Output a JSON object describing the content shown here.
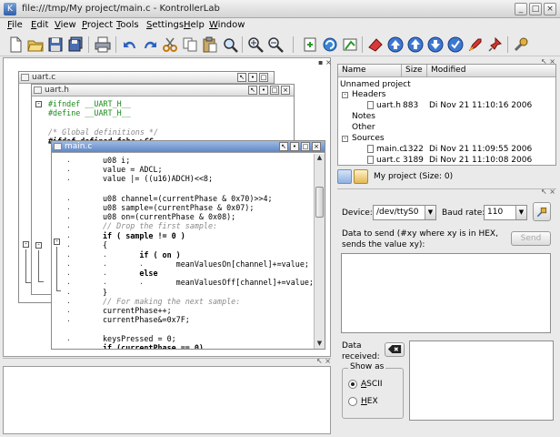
{
  "window": {
    "title": "file:///tmp/My project/main.c - KontrollerLab",
    "minimize": "_",
    "maximize": "□",
    "close": "×"
  },
  "menu": {
    "items": [
      {
        "first": "F",
        "rest": "ile"
      },
      {
        "first": "E",
        "rest": "dit"
      },
      {
        "first": "V",
        "rest": "iew"
      },
      {
        "first": "P",
        "rest": "roject"
      },
      {
        "first": "T",
        "rest": "ools"
      },
      {
        "first": "S",
        "rest": "ettings"
      },
      {
        "first": "H",
        "rest": "elp"
      },
      {
        "first": "W",
        "rest": "indow"
      }
    ]
  },
  "toolbar": {
    "icons": [
      "new-file-icon",
      "open-file-icon",
      "save-icon",
      "save-all-icon",
      "print-icon",
      "undo-icon",
      "redo-icon",
      "cut-icon",
      "copy-icon",
      "paste-icon",
      "find-icon",
      "zoom-in-icon",
      "zoom-out-icon",
      "new-project-icon",
      "compile-icon",
      "build-icon",
      "erase-icon",
      "upload-icon",
      "upload-all-icon",
      "download-icon",
      "verify-icon",
      "rocket-icon",
      "pin-icon",
      "config-icon"
    ]
  },
  "editor": {
    "windows": {
      "uart_c": {
        "title": "uart.c"
      },
      "uart_h": {
        "title": "uart.h",
        "lines": [
          "#ifndef __UART_H__",
          "#define __UART_H__",
          "",
          "/* Global definitions */",
          "#ifdef defined fsbc >CC"
        ]
      },
      "main_c": {
        "title": "main.c",
        "lines": [
          "u08 i;",
          "value = ADCL;",
          "value |= ((u16)ADCH)<<8;",
          "",
          "u08 channel=(currentPhase & 0x70)>>4;",
          "u08 sample=(currentPhase & 0x07);",
          "u08 on=(currentPhase & 0x08);",
          "// Drop the first sample:",
          "if ( sample != 0 )",
          "{",
          "        if ( on )",
          "                meanValuesOn[channel]+=value;",
          "        else",
          "                meanValuesOff[channel]+=value;",
          "}",
          "// For making the next sample:",
          "currentPhase++;",
          "currentPhase&=0x7F;",
          "",
          "keysPressed = 0;",
          "",
          "if (currentPhase == 0)"
        ]
      }
    },
    "dot": "."
  },
  "project": {
    "columns": {
      "name": "Name",
      "size": "Size",
      "modified": "Modified"
    },
    "root": "Unnamed project",
    "headers": "Headers",
    "notes": "Notes",
    "other": "Other",
    "sources": "Sources",
    "files": {
      "uart_h": {
        "name": "uart.h",
        "size": "883",
        "modified": "Di Nov 21 11:10:16 2006"
      },
      "main_c": {
        "name": "main.c",
        "size": "1322",
        "modified": "Di Nov 21 11:09:55 2006"
      },
      "uart_c": {
        "name": "uart.c",
        "size": "3189",
        "modified": "Di Nov 21 11:10:08 2006"
      }
    },
    "summary": "My project (Size: 0)"
  },
  "serial": {
    "device_label": "Device:",
    "device_value": "/dev/ttyS0",
    "baud_label": "Baud rate:",
    "baud_value": "110",
    "send_hint": "Data to send (#xy where xy is in HEX, sends the value xy):",
    "send_button": "Send",
    "received_label": "Data received:",
    "show_as": "Show as",
    "ascii": {
      "first": "A",
      "rest": "SCII"
    },
    "hex": {
      "first": "H",
      "rest": "EX"
    },
    "mode": "ASCII"
  },
  "colors": {
    "accent": "#5f87c6",
    "keyword": "#000000",
    "comment": "#8a8a8a",
    "preprocessor": "#1b8a1b",
    "number": "#b8352a"
  }
}
